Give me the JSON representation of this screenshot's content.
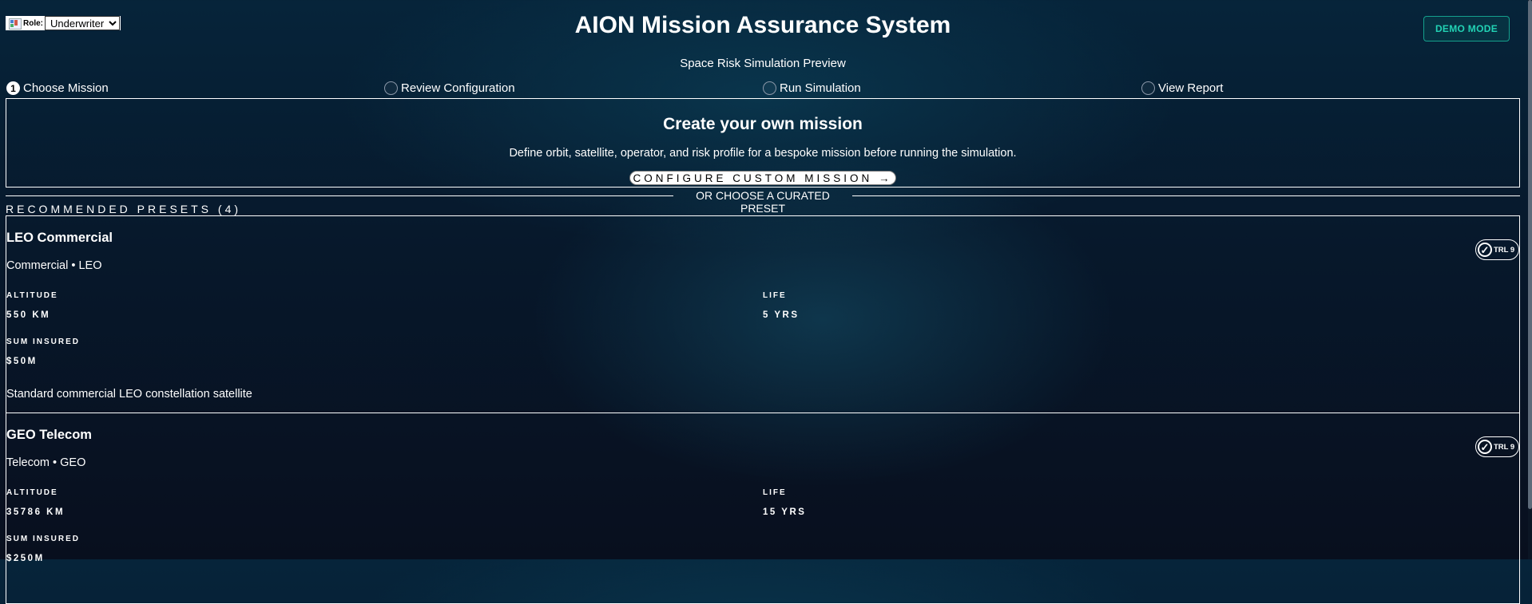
{
  "header": {
    "role_label": "Role:",
    "role_value": "Underwriter",
    "title": "AION Mission Assurance System",
    "subtitle": "Space Risk Simulation Preview",
    "demo_button": "DEMO MODE"
  },
  "steps": [
    {
      "number": "1",
      "label": "Choose Mission"
    },
    {
      "number": "",
      "label": "Review Configuration"
    },
    {
      "number": "",
      "label": "Run Simulation"
    },
    {
      "number": "",
      "label": "View Report"
    }
  ],
  "custom_mission": {
    "title": "Create your own mission",
    "description": "Define orbit, satellite, operator, and risk profile for a bespoke mission before running the simulation.",
    "button": "CONFIGURE CUSTOM MISSION →"
  },
  "divider_text": "OR CHOOSE A CURATED PRESET",
  "presets_heading": "RECOMMENDED PRESETS (4)",
  "presets": [
    {
      "name": "LEO Commercial",
      "meta": "Commercial • LEO",
      "badge": "TRL 9",
      "altitude_label": "ALTITUDE",
      "altitude": "550 KM",
      "life_label": "LIFE",
      "life": "5 YRS",
      "sum_label": "SUM INSURED",
      "sum": "$50M",
      "description": "Standard commercial LEO constellation satellite"
    },
    {
      "name": "GEO Telecom",
      "meta": "Telecom • GEO",
      "badge": "TRL 9",
      "altitude_label": "ALTITUDE",
      "altitude": "35786 KM",
      "life_label": "LIFE",
      "life": "15 YRS",
      "sum_label": "SUM INSURED",
      "sum": "$250M",
      "description": ""
    }
  ],
  "colors": {
    "accent": "#22d3b5",
    "background": "#07182b"
  }
}
